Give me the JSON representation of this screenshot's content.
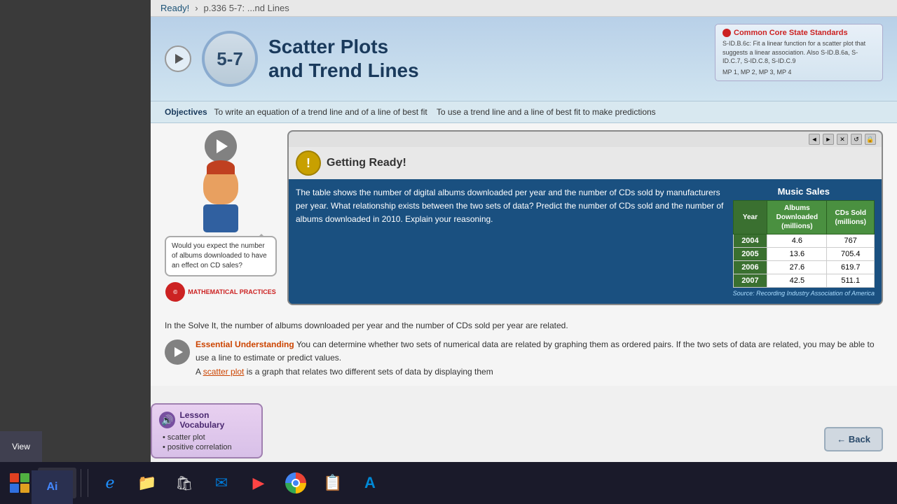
{
  "breadcrumb": {
    "ready": "Ready!",
    "separator": "›",
    "page": "p.336 5-7: ...nd Lines"
  },
  "lesson": {
    "number": "5-7",
    "title_line1": "Scatter Plots",
    "title_line2": "and Trend Lines",
    "play_button_label": "Play",
    "objectives_label": "Objectives",
    "objective1": "To write an equation of a trend line and of a line of best fit",
    "objective2": "To use a trend line and a line of best fit to make predictions"
  },
  "standards": {
    "title": "Common Core State Standards",
    "dot": "●",
    "content": "S-ID.B.6c: Fit a linear function for a scatter plot that suggests a linear association. Also S-ID.B.6a, S-ID.C.7, S-ID.C.8, S-ID.C.9",
    "mp": "MP 1, MP 2, MP 3, MP 4"
  },
  "solve_it": {
    "title": "Getting Ready!",
    "icon_text": "!",
    "text": "The table shows the number of digital albums downloaded per year and the number of CDs sold by manufacturers per year. What relationship exists between the two sets of data? Predict the number of CDs sold and the number of albums downloaded in 2010. Explain your reasoning.",
    "titlebar_controls": [
      "◄",
      "►",
      "✕",
      "↺",
      "🔒"
    ]
  },
  "music_sales": {
    "title": "Music Sales",
    "col1": "Year",
    "col2_line1": "Albums",
    "col2_line2": "Downloaded",
    "col2_line3": "(millions)",
    "col3_line1": "CDs Sold",
    "col3_line2": "(millions)",
    "rows": [
      {
        "year": "2004",
        "albums": "4.6",
        "cds": "767"
      },
      {
        "year": "2005",
        "albums": "13.6",
        "cds": "705.4"
      },
      {
        "year": "2006",
        "albums": "27.6",
        "cds": "619.7"
      },
      {
        "year": "2007",
        "albums": "42.5",
        "cds": "511.1"
      }
    ],
    "source": "Source: Recording Industry Association of America"
  },
  "character": {
    "speech_bubble": "Would you expect the number of albums downloaded to have an effect on CD sales?"
  },
  "bottom": {
    "solve_it_text": "In the Solve It, the number of albums downloaded per year and the number of CDs sold per year are related.",
    "eu_label": "Essential Understanding",
    "eu_text": "You can determine whether two sets of numerical data are related by graphing them as ordered pairs. If the two sets of data are related, you may be able to use a line to estimate or predict values.",
    "scatter_plot_intro": "A scatter plot is a graph that relates two different sets of data by displaying them"
  },
  "vocabulary": {
    "title": "Lesson Vocabulary",
    "items": [
      "• scatter plot",
      "• positive correlation"
    ]
  },
  "back_button": "← Back",
  "taskbar": {
    "view_label": "View",
    "ai_label": "Ai",
    "items": [
      {
        "name": "windows-search",
        "label": ""
      },
      {
        "name": "task-view",
        "label": ""
      },
      {
        "name": "internet-explorer",
        "label": ""
      },
      {
        "name": "file-explorer",
        "label": ""
      },
      {
        "name": "microsoft-store",
        "label": ""
      },
      {
        "name": "mail",
        "label": ""
      },
      {
        "name": "media-player",
        "label": ""
      },
      {
        "name": "chrome",
        "label": ""
      },
      {
        "name": "sticky-notes",
        "label": ""
      },
      {
        "name": "azure",
        "label": ""
      }
    ]
  },
  "math_practices": {
    "label": "MATHEMATICAL PRACTICES"
  }
}
